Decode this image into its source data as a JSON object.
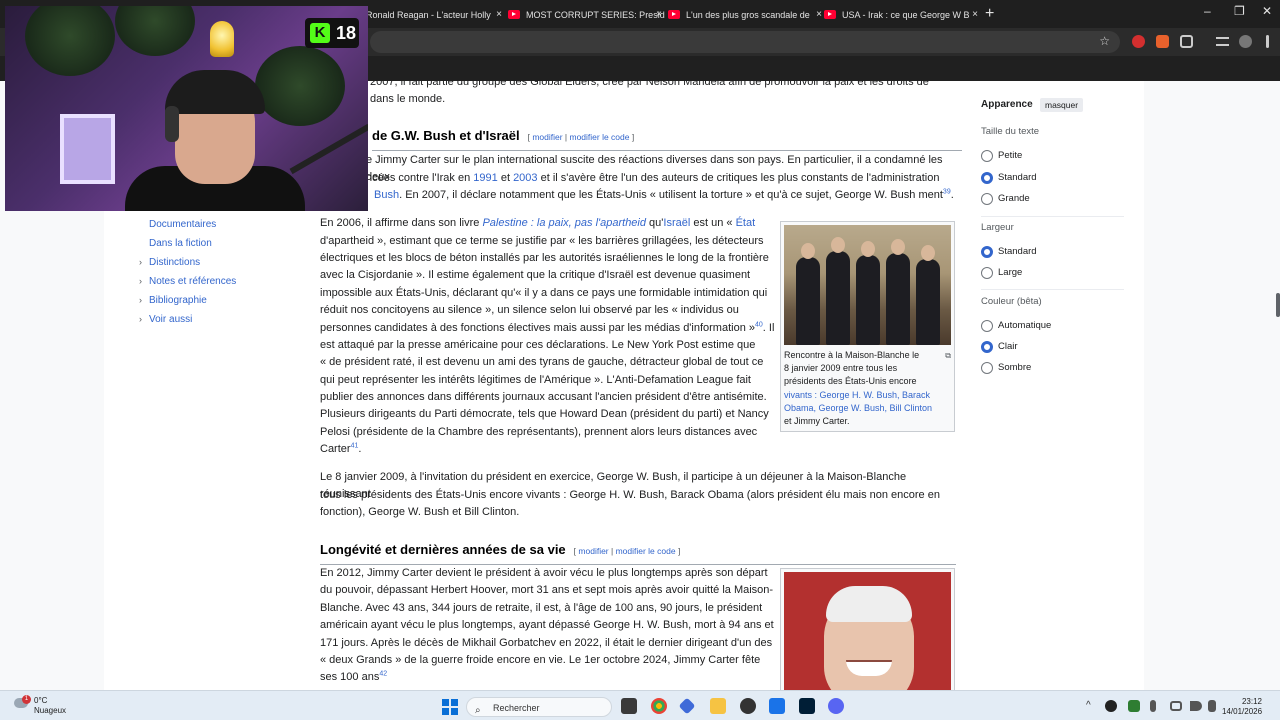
{
  "browser": {
    "tabs": [
      {
        "title": "Ronald Reagan - L'acteur Holly"
      },
      {
        "title": "MOST CORRUPT SERIES: Presid"
      },
      {
        "title": "L'un des plus gros scandale de"
      },
      {
        "title": "USA - Irak : ce que George W B"
      }
    ],
    "new_tab": "+",
    "close": "×",
    "min": "–",
    "max": "❐",
    "winclose": "✕"
  },
  "article": {
    "top_line_1": "2007, il fait partie du groupe des Global Elders, créé par Nelson Mandela afin de promouvoir la paix et les droits de",
    "top_line_2": "dans le monde.",
    "section1": {
      "title": "de G.W. Bush et d'Israël",
      "edit_a": "modifier",
      "sep": " | ",
      "edit_b": "modifier le code"
    },
    "s1_l1": "e Jimmy Carter sur le plan international suscite des réactions diverses dans son pays. En particulier, il a condamné les deux",
    "s1_l2a": "ncées contre l'Irak en ",
    "s1_l2_1991": "1991",
    "s1_l2b": " et ",
    "s1_l2_2003": "2003",
    "s1_l2c": " et il s'avère être l'un des auteurs de critiques les plus constants de l'administration",
    "s1_l3a": "Bush",
    "s1_l3b": ". En 2007, il déclare notamment que les États-Unis « utilisent la torture » et qu'à ce sujet, George W. Bush ment",
    "s1_ref39": "39",
    "s1_l3c": ".",
    "p2": [
      {
        "t": "En 2006, il affirme dans son livre ",
        "c": ""
      },
      {
        "t": "Palestine : la paix, pas l'apartheid",
        "c": "a i"
      },
      {
        "t": " qu'",
        "c": ""
      },
      {
        "t": "Israël",
        "c": "a"
      },
      {
        "t": " est un « ",
        "c": ""
      },
      {
        "t": "État",
        "c": "a"
      }
    ],
    "p2_lines": [
      "d'apartheid », estimant que ce terme se justifie par « les barrières grillagées, les détecteurs",
      "électriques et les blocs de béton installés par les autorités israéliennes le long de la frontière",
      "avec la Cisjordanie ». Il estime également que la critique d'Israël est devenue quasiment",
      "impossible aux États-Unis, déclarant qu'« il y a dans ce pays une formidable intimidation qui",
      "réduit nos concitoyens au silence », un silence selon lui observé par les « individus ou",
      "personnes candidates à des fonctions électives mais aussi par les médias d'information »",
      "est attaqué par la presse américaine pour ces déclarations. Le New York Post estime que",
      "« de président raté, il est devenu un ami des tyrans de gauche, détracteur global de tout ce",
      "qui peut représenter les intérêts légitimes de l'Amérique ». L'Anti-Defamation League fait",
      "publier des annonces dans différents journaux accusant l'ancien président d'être antisémite.",
      "Plusieurs dirigeants du Parti démocrate, tels que Howard Dean (président du parti) et Nancy",
      "Pelosi (présidente de la Chambre des représentants), prennent alors leurs distances avec",
      "Carter"
    ],
    "ref40": "40",
    "il": ". Il",
    "ref41": "41",
    "dot": ".",
    "p3_lines": [
      "Le 8 janvier 2009, à l'invitation du président en exercice, George W. Bush, il participe à un déjeuner à la Maison-Blanche réunissant",
      "tous les présidents des États-Unis encore vivants : George H. W. Bush, Barack Obama (alors président élu mais non encore en",
      "fonction), George W. Bush et Bill Clinton."
    ],
    "section2": {
      "title": "Longévité et dernières années de sa vie",
      "edit_a": "modifier",
      "sep": " | ",
      "edit_b": "modifier le code"
    },
    "p4_lines": [
      "En 2012, Jimmy Carter devient le président à avoir vécu le plus longtemps après son départ",
      "du pouvoir, dépassant Herbert Hoover, mort 31 ans et sept mois après avoir quitté la Maison-",
      "Blanche. Avec 43 ans, 344 jours de retraite, il est, à l'âge de 100 ans, 90 jours, le président",
      "américain ayant vécu le plus longtemps, ayant dépassé George H. W. Bush, mort à 94 ans et",
      "171 jours. Après le décès de Mikhail Gorbatchev en 2022, il était le dernier dirigeant d'un des",
      "« deux Grands » de la guerre froide encore en vie. Le 1er octobre 2024, Jimmy Carter fête",
      "ses 100 ans"
    ],
    "ref42": "42",
    "caption1": [
      "Rencontre à la Maison-Blanche le",
      "8 janvier 2009 entre tous les",
      "présidents des États-Unis encore",
      "vivants : George H. W. Bush, Barack",
      "Obama, George W. Bush, Bill Clinton",
      "et Jimmy Carter."
    ],
    "magnify": "⧉"
  },
  "toc": [
    {
      "label": "Documentaires",
      "chev": ""
    },
    {
      "label": "Dans la fiction",
      "chev": ""
    },
    {
      "label": "Distinctions",
      "chev": "›"
    },
    {
      "label": "Notes et références",
      "chev": "›"
    },
    {
      "label": "Bibliographie",
      "chev": "›"
    },
    {
      "label": "Voir aussi",
      "chev": "›"
    }
  ],
  "appearance": {
    "title": "Apparence",
    "hide": "masquer",
    "text_size_label": "Taille du texte",
    "text_size_options": [
      "Petite",
      "Standard",
      "Grande"
    ],
    "width_label": "Largeur",
    "width_options": [
      "Standard",
      "Large"
    ],
    "color_label": "Couleur (bêta)",
    "color_options": [
      "Automatique",
      "Clair",
      "Sombre"
    ]
  },
  "webcam": {
    "badge_text": "18",
    "badge_letter": "K"
  },
  "taskbar": {
    "temp": "0°C",
    "weather": "Nuageux",
    "weather_badge": "1",
    "search_placeholder": "Rechercher",
    "search_icon": "⌕",
    "time": "23:12",
    "date": "14/01/2026",
    "tray_up": "^"
  }
}
